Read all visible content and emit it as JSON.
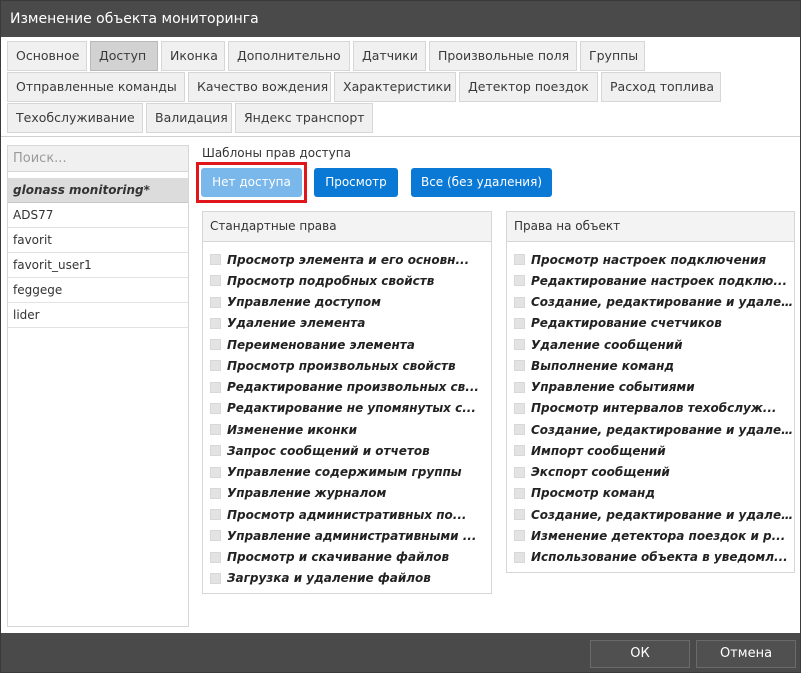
{
  "window": {
    "title": "Изменение объекта мониторинга"
  },
  "tabs": [
    {
      "label": "Основное"
    },
    {
      "label": "Доступ"
    },
    {
      "label": "Иконка"
    },
    {
      "label": "Дополнительно"
    },
    {
      "label": "Датчики"
    },
    {
      "label": "Произвольные поля"
    },
    {
      "label": "Группы"
    },
    {
      "label": "Отправленные команды"
    },
    {
      "label": "Качество вождения"
    },
    {
      "label": "Характеристики"
    },
    {
      "label": "Детектор поездок"
    },
    {
      "label": "Расход топлива"
    },
    {
      "label": "Техобслуживание"
    },
    {
      "label": "Валидация"
    },
    {
      "label": "Яндекс транспорт"
    }
  ],
  "active_tab": "Доступ",
  "users": {
    "search_placeholder": "Поиск...",
    "items": [
      {
        "label": "glonass monitoring*"
      },
      {
        "label": "ADS77"
      },
      {
        "label": "favorit"
      },
      {
        "label": "favorit_user1"
      },
      {
        "label": "feggege"
      },
      {
        "label": "lider"
      }
    ]
  },
  "templates": {
    "label": "Шаблоны прав доступа",
    "no_access": "Нет доступа",
    "view": "Просмотр",
    "all": "Все (без удаления)"
  },
  "standard_rights": {
    "title": "Стандартные права",
    "items": [
      {
        "label": "Просмотр элемента и его основн..."
      },
      {
        "label": "Просмотр подробных свойств"
      },
      {
        "label": "Управление доступом"
      },
      {
        "label": "Удаление элемента"
      },
      {
        "label": "Переименование элемента"
      },
      {
        "label": "Просмотр произвольных свойств"
      },
      {
        "label": "Редактирование произвольных св..."
      },
      {
        "label": "Редактирование не упомянутых с..."
      },
      {
        "label": "Изменение иконки"
      },
      {
        "label": "Запрос сообщений и отчетов"
      },
      {
        "label": "Управление содержимым группы"
      },
      {
        "label": "Управление журналом"
      },
      {
        "label": "Просмотр административных по..."
      },
      {
        "label": "Управление административными ..."
      },
      {
        "label": "Просмотр и скачивание файлов"
      },
      {
        "label": "Загрузка и удаление файлов"
      }
    ]
  },
  "object_rights": {
    "title": "Права на объект",
    "items": [
      {
        "label": "Просмотр настроек подключения"
      },
      {
        "label": "Редактирование настроек подклю..."
      },
      {
        "label": "Создание, редактирование и удале..."
      },
      {
        "label": "Редактирование счетчиков"
      },
      {
        "label": "Удаление сообщений"
      },
      {
        "label": "Выполнение команд"
      },
      {
        "label": "Управление событиями"
      },
      {
        "label": "Просмотр интервалов техобслуж..."
      },
      {
        "label": "Создание, редактирование и удале..."
      },
      {
        "label": "Импорт сообщений"
      },
      {
        "label": "Экспорт сообщений"
      },
      {
        "label": "Просмотр команд"
      },
      {
        "label": "Создание, редактирование и удале..."
      },
      {
        "label": "Изменение детектора поездок и р..."
      },
      {
        "label": "Использование объекта в уведомл..."
      }
    ]
  },
  "footer": {
    "ok": "ОК",
    "cancel": "Отмена"
  }
}
